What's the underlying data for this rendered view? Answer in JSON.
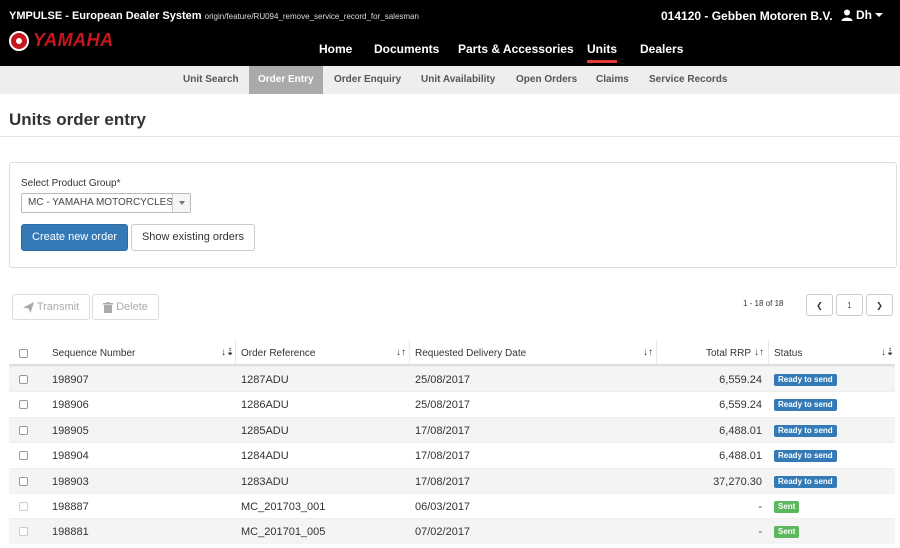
{
  "header": {
    "system_title": "YMPULSE - European Dealer System",
    "branch": "origin/feature/RU094_remove_service_record_for_salesman",
    "logo_text": "YAMAHA",
    "dealer": "014120 - Gebben Motoren B.V.",
    "user": "Dh",
    "nav": [
      {
        "label": "Home"
      },
      {
        "label": "Documents"
      },
      {
        "label": "Parts & Accessories"
      },
      {
        "label": "Units"
      },
      {
        "label": "Dealers"
      }
    ]
  },
  "subnav": [
    {
      "label": "Unit Search"
    },
    {
      "label": "Order Entry"
    },
    {
      "label": "Order Enquiry"
    },
    {
      "label": "Unit Availability"
    },
    {
      "label": "Open Orders"
    },
    {
      "label": "Claims"
    },
    {
      "label": "Service Records"
    }
  ],
  "page": {
    "title": "Units order entry"
  },
  "form": {
    "product_group_label": "Select Product Group*",
    "product_group_value": "MC - YAMAHA MOTORCYCLES",
    "create_label": "Create new order",
    "show_label": "Show existing orders"
  },
  "toolbar": {
    "transmit_label": "Transmit",
    "delete_label": "Delete",
    "pager_info": "1 - 18 of 18",
    "page_number": "1",
    "prev_symbol": "❮",
    "next_symbol": "❯"
  },
  "table": {
    "columns": {
      "sequence": "Sequence Number",
      "reference": "Order Reference",
      "delivery": "Requested Delivery Date",
      "rrp": "Total RRP",
      "status": "Status"
    },
    "rows": [
      {
        "seq": "198907",
        "ref": "1287ADU",
        "date": "25/08/2017",
        "rrp": "6,559.24",
        "status": "Ready to send"
      },
      {
        "seq": "198906",
        "ref": "1286ADU",
        "date": "25/08/2017",
        "rrp": "6,559.24",
        "status": "Ready to send"
      },
      {
        "seq": "198905",
        "ref": "1285ADU",
        "date": "17/08/2017",
        "rrp": "6,488.01",
        "status": "Ready to send"
      },
      {
        "seq": "198904",
        "ref": "1284ADU",
        "date": "17/08/2017",
        "rrp": "6,488.01",
        "status": "Ready to send"
      },
      {
        "seq": "198903",
        "ref": "1283ADU",
        "date": "17/08/2017",
        "rrp": "37,270.30",
        "status": "Ready to send"
      },
      {
        "seq": "198887",
        "ref": "MC_201703_001",
        "date": "06/03/2017",
        "rrp": "-",
        "status": "Sent"
      },
      {
        "seq": "198881",
        "ref": "MC_201701_005",
        "date": "07/02/2017",
        "rrp": "-",
        "status": "Sent"
      }
    ]
  },
  "colors": {
    "ready_badge": "#337ab7",
    "sent_badge": "#5cb85c",
    "active_nav_underline": "#e53935",
    "brand_red": "#c8161d"
  }
}
